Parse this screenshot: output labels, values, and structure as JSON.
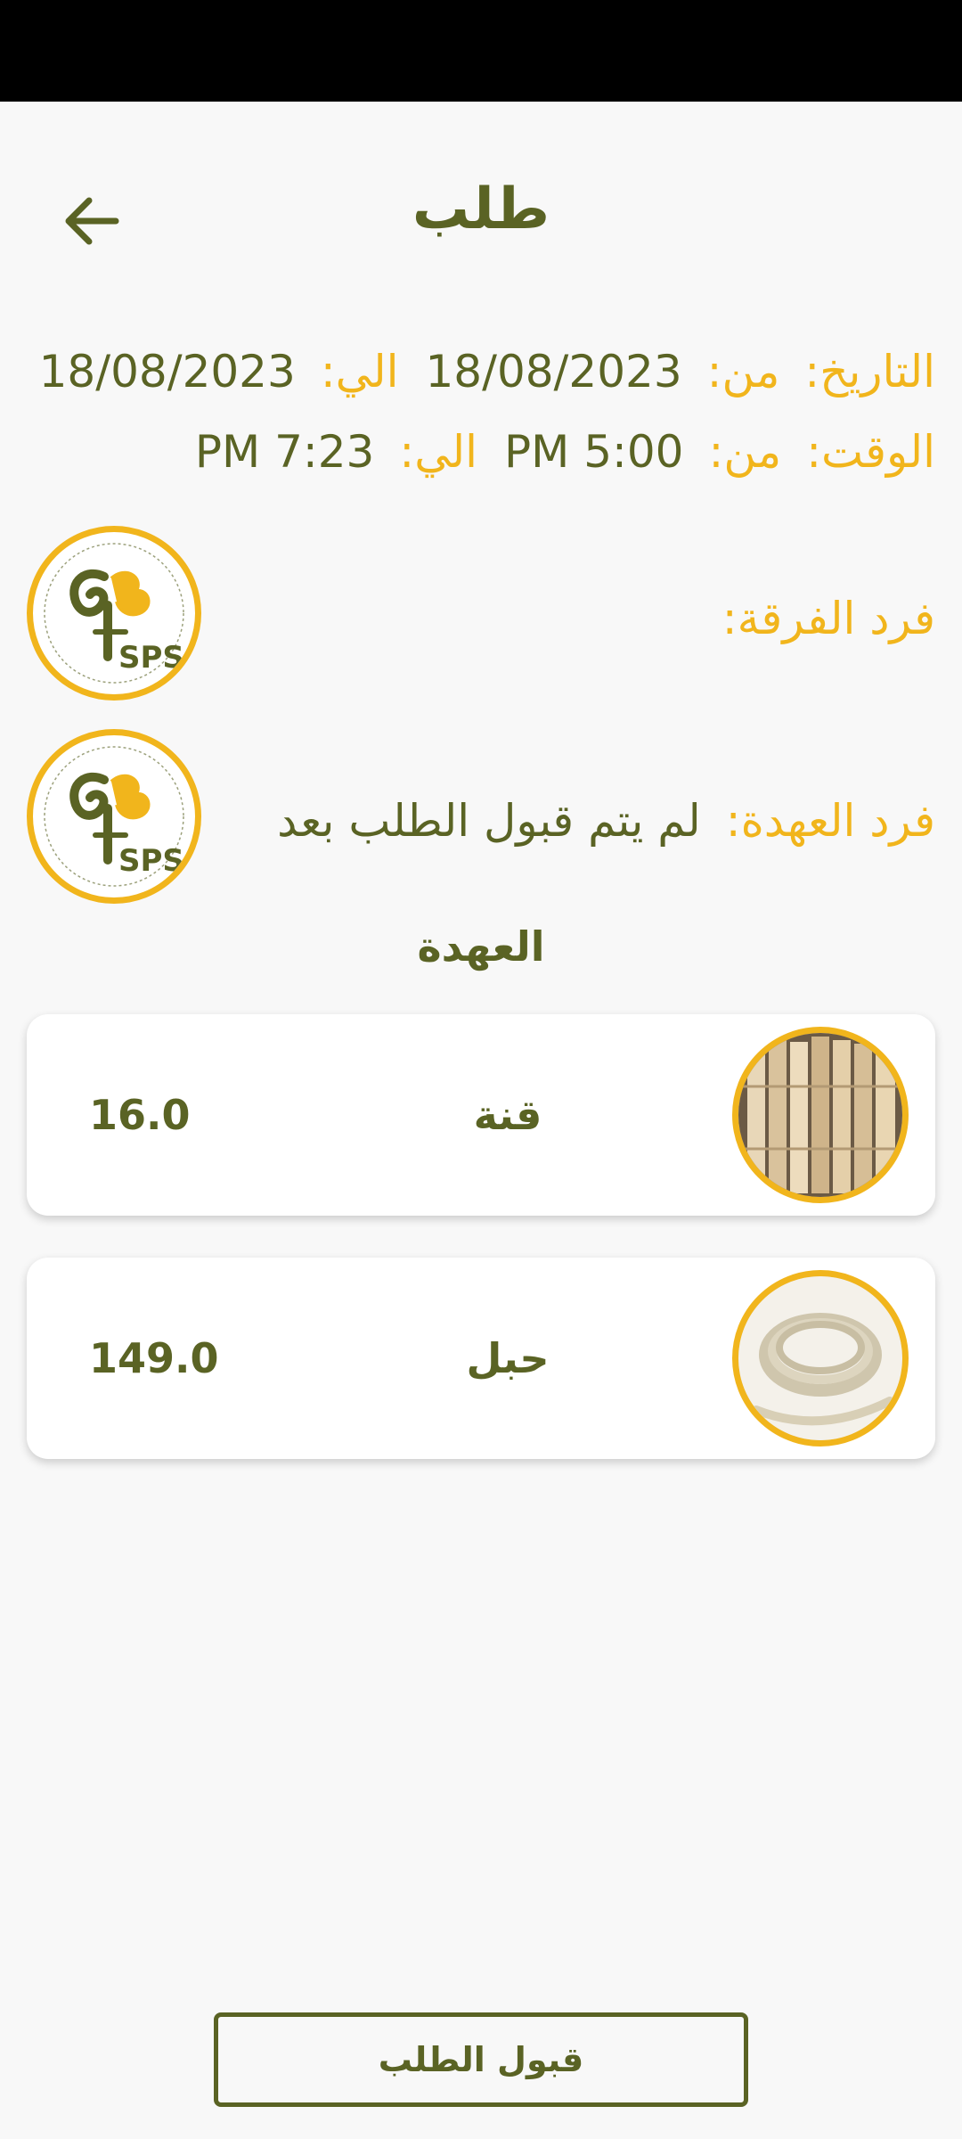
{
  "header": {
    "title": "طلب",
    "back_icon": "arrow-left-icon"
  },
  "request": {
    "date_label": "التاريخ:",
    "from_label": "من:",
    "date_from": "18/08/2023",
    "to_label": "الي:",
    "date_to": "18/08/2023",
    "time_label": "الوقت:",
    "time_from": "PM 5:00",
    "time_to": "PM 7:23",
    "team_member_label": "فرد الفرقة:",
    "custody_member_label": "فرد العهدة:",
    "custody_member_status": "لم يتم قبول الطلب بعد"
  },
  "custody": {
    "section_title": "العهدة",
    "items": [
      {
        "name": "قنة",
        "quantity": "16.0",
        "image": "bamboo-poles-image"
      },
      {
        "name": "حبل",
        "quantity": "149.0",
        "image": "rope-coil-image"
      }
    ]
  },
  "actions": {
    "accept_label": "قبول الطلب"
  },
  "colors": {
    "primary": "#5a6324",
    "accent": "#f1b51c",
    "background": "#f8f8f8"
  }
}
